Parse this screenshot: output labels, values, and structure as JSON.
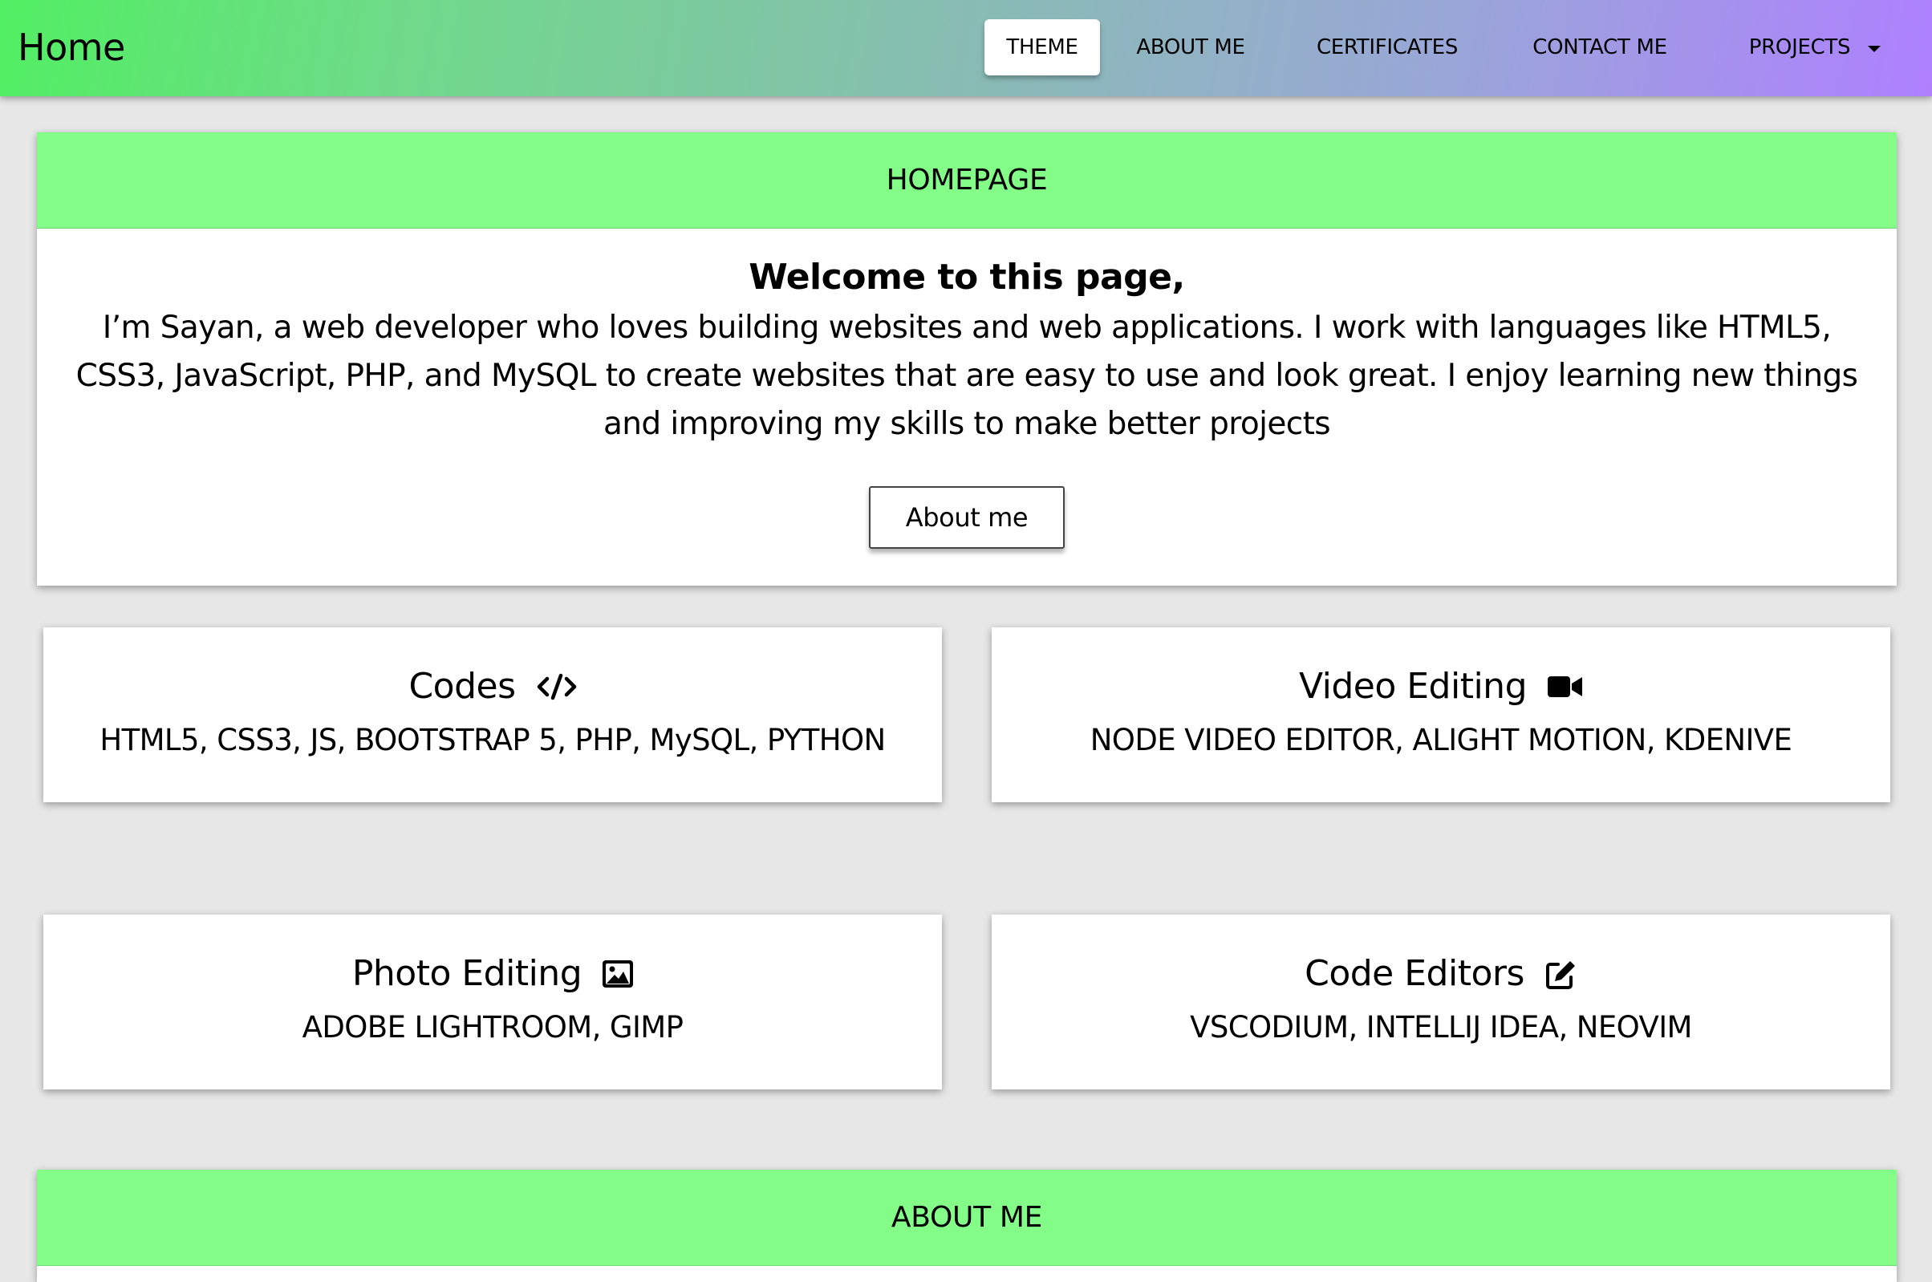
{
  "navbar": {
    "brand": "Home",
    "items": [
      {
        "label": "THEME",
        "active": true
      },
      {
        "label": "ABOUT ME"
      },
      {
        "label": "CERTIFICATES"
      },
      {
        "label": "CONTACT ME"
      },
      {
        "label": "PROJECTS",
        "dropdown": true
      }
    ],
    "gradient": [
      "#52ef63",
      "#ae80ff"
    ]
  },
  "hero": {
    "header": "HOMEPAGE",
    "title": "Welcome to this page,",
    "text": "I’m Sayan, a web developer who loves building websites and web applications. I work with languages like HTML5, CSS3, JavaScript, PHP, and MySQL to create websites that are easy to use and look great. I enjoy learning new things and improving my skills to make better projects",
    "button": "About me"
  },
  "skills": [
    {
      "title": "Codes",
      "icon": "code-icon",
      "text": "HTML5, CSS3, JS, BOOTSTRAP 5, PHP, MySQL, PYTHON"
    },
    {
      "title": "Video Editing",
      "icon": "video-camera-icon",
      "text": "NODE VIDEO EDITOR, ALIGHT MOTION, KDENIVE"
    },
    {
      "title": "Photo Editing",
      "icon": "image-icon",
      "text": "ADOBE LIGHTROOM, GIMP"
    },
    {
      "title": "Code Editors",
      "icon": "edit-icon",
      "text": "VSCODIUM, INTELLIJ IDEA, NEOVIM"
    }
  ],
  "about": {
    "header": "ABOUT ME"
  },
  "colors": {
    "header_bg": "#83fd88",
    "page_bg": "#e7e7e7"
  }
}
